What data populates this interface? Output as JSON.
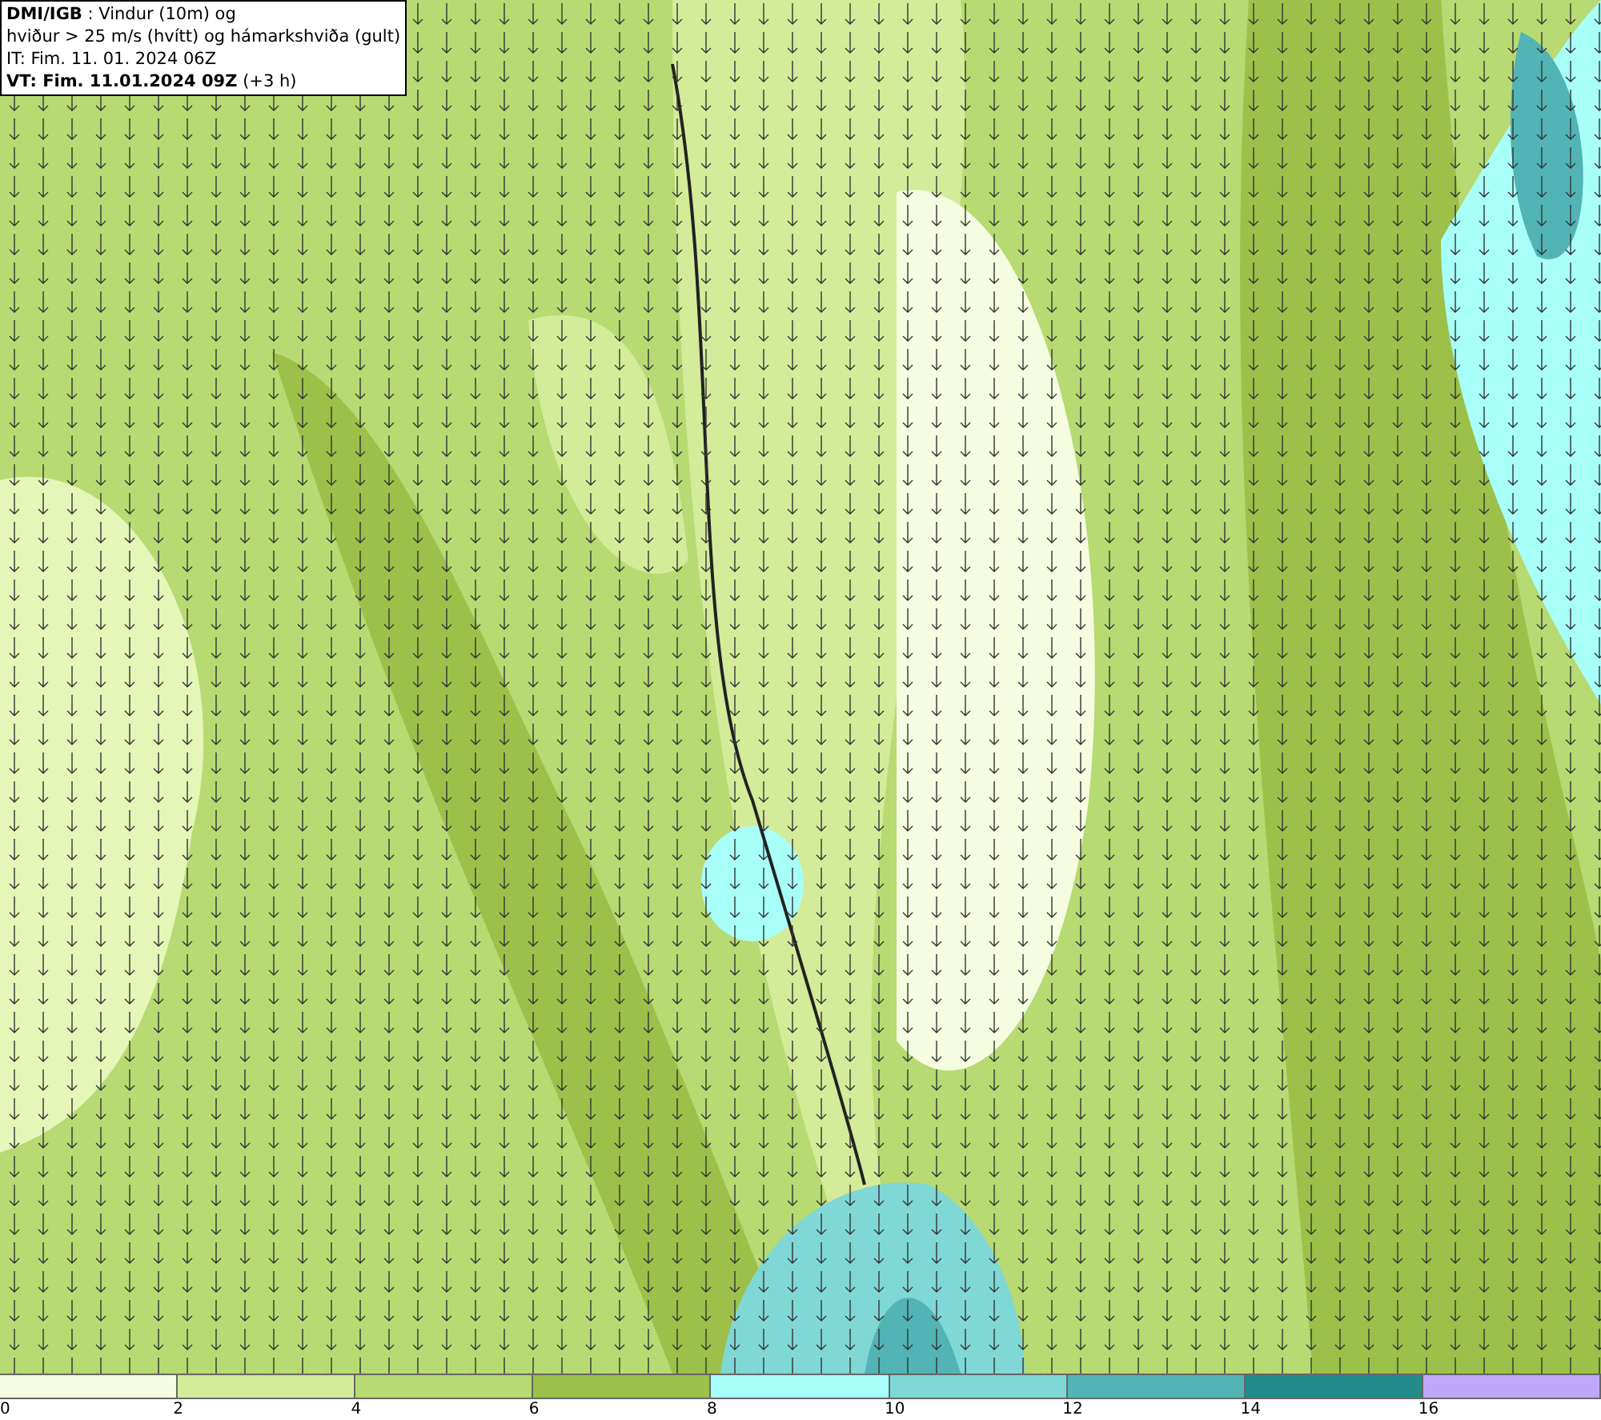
{
  "header": {
    "lines": [
      "**DMI/IGB** : Vindur (10m) og",
      "hviður > 25 m/s (hvítt) og hámarkshviða (gult)",
      "IT: Fim. 11. 01. 2024 06Z",
      "**VT: Fim. 11.01.2024 09Z** (+3 h)"
    ]
  },
  "legend": {
    "bins": [
      {
        "color": "#f5fce0"
      },
      {
        "color": "#d4eb9a"
      },
      {
        "color": "#b7da72"
      },
      {
        "color": "#9cc04a"
      },
      {
        "color": "#a8fff8"
      },
      {
        "color": "#7fd8d6"
      },
      {
        "color": "#52b4b4"
      },
      {
        "color": "#228b8a"
      },
      {
        "color": "#c0a8f8"
      }
    ],
    "ticks": [
      "0",
      "2",
      "4",
      "6",
      "8",
      "10",
      "12",
      "14",
      "16"
    ]
  }
}
